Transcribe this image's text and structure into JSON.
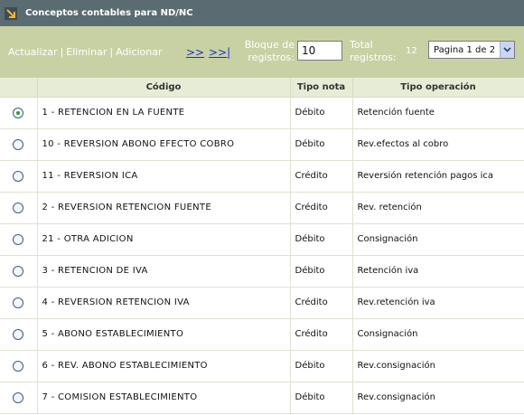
{
  "header": {
    "title": "Conceptos contables para ND/NC",
    "icon": "arrow-down-right-icon"
  },
  "toolbar": {
    "actualizar": "Actualizar",
    "eliminar": "Eliminar",
    "adicionar": "Adicionar",
    "separator": "|",
    "next": ">>",
    "last": ">>|",
    "bloque_label": "Bloque de registros:",
    "bloque_value": "10",
    "total_label": "Total registros:",
    "total_value": "12",
    "page_select": "Pagina 1 de 2"
  },
  "table": {
    "headers": {
      "codigo": "Código",
      "tipo_nota": "Tipo nota",
      "tipo_operacion": "Tipo operación"
    },
    "rows": [
      {
        "selected": true,
        "codigo": "1 - RETENCION EN LA FUENTE",
        "tipo_nota": "Débito",
        "tipo_operacion": "Retención fuente"
      },
      {
        "selected": false,
        "codigo": "10 - REVERSION ABONO EFECTO COBRO",
        "tipo_nota": "Débito",
        "tipo_operacion": "Rev.efectos al cobro"
      },
      {
        "selected": false,
        "codigo": "11 - REVERSION ICA",
        "tipo_nota": "Crédito",
        "tipo_operacion": "Reversión retención pagos ica"
      },
      {
        "selected": false,
        "codigo": "2 - REVERSION RETENCION FUENTE",
        "tipo_nota": "Crédito",
        "tipo_operacion": "Rev. retención"
      },
      {
        "selected": false,
        "codigo": "21 - OTRA ADICION",
        "tipo_nota": "Débito",
        "tipo_operacion": "Consignación"
      },
      {
        "selected": false,
        "codigo": "3 - RETENCION DE IVA",
        "tipo_nota": "Débito",
        "tipo_operacion": "Retención iva"
      },
      {
        "selected": false,
        "codigo": "4 - REVERSION RETENCION IVA",
        "tipo_nota": "Crédito",
        "tipo_operacion": "Rev.retención iva"
      },
      {
        "selected": false,
        "codigo": "5 - ABONO ESTABLECIMIENTO",
        "tipo_nota": "Crédito",
        "tipo_operacion": "Consignación"
      },
      {
        "selected": false,
        "codigo": "6 - REV. ABONO ESTABLECIMIENTO",
        "tipo_nota": "Débito",
        "tipo_operacion": "Rev.consignación"
      },
      {
        "selected": false,
        "codigo": "7 - COMISION ESTABLECIMIENTO",
        "tipo_nota": "Débito",
        "tipo_operacion": "Rev.consignación"
      }
    ]
  },
  "colors": {
    "titlebar": "#5a6c72",
    "toolbar": "#c8d1a4",
    "header_row": "#e7ecd7",
    "link": "#1d2fd0",
    "radio_selected": "#2e9b2e"
  }
}
